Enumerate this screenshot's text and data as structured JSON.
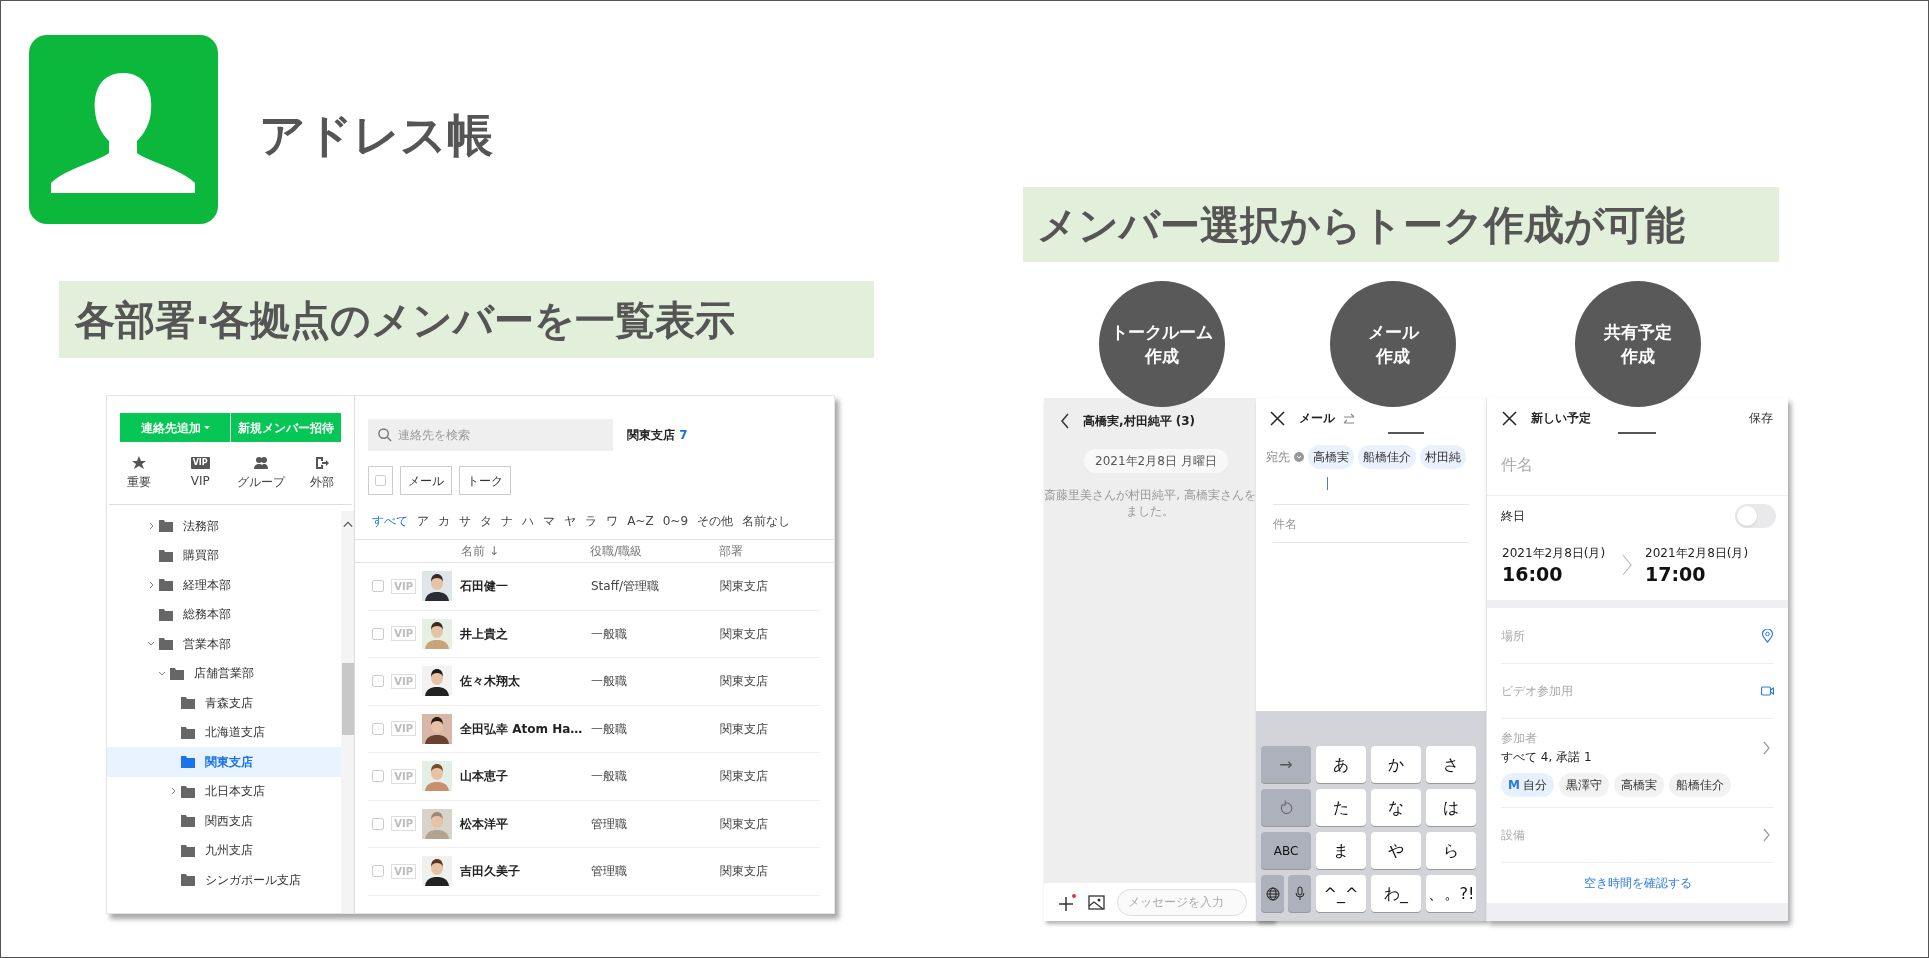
{
  "slide": {
    "title": "アドレス帳",
    "caption_left": "各部署·各拠点のメンバーを一覧表示",
    "caption_right": "メンバー選択からトーク作成が可能",
    "badges": [
      {
        "lines": [
          "トークルーム",
          "作成"
        ]
      },
      {
        "lines": [
          "メール",
          "作成"
        ]
      },
      {
        "lines": [
          "共有予定",
          "作成"
        ]
      }
    ]
  },
  "address_book": {
    "toolbar_buttons": [
      {
        "label": "連絡先追加",
        "dropdown": true
      },
      {
        "label": "新規メンバー招待",
        "dropdown": false
      }
    ],
    "quick_filters": [
      {
        "label": "重要",
        "kind": "star"
      },
      {
        "label": "VIP",
        "kind": "vip",
        "icon_text": "VIP"
      },
      {
        "label": "グループ",
        "kind": "group"
      },
      {
        "label": "外部",
        "kind": "external"
      }
    ],
    "tree": [
      {
        "label": "法務部",
        "has_children": true,
        "expanded": false,
        "selected": false
      },
      {
        "label": "購買部",
        "has_children": false,
        "selected": false
      },
      {
        "label": "経理本部",
        "has_children": true,
        "expanded": false,
        "selected": false
      },
      {
        "label": "総務本部",
        "has_children": false,
        "selected": false
      },
      {
        "label": "営業本部",
        "has_children": true,
        "expanded": true,
        "selected": false,
        "children": [
          {
            "label": "店舗営業部",
            "has_children": true,
            "expanded": true,
            "selected": false,
            "children": [
              {
                "label": "青森支店",
                "has_children": false,
                "selected": false
              },
              {
                "label": "北海道支店",
                "has_children": false,
                "selected": false
              },
              {
                "label": "関東支店",
                "has_children": false,
                "selected": true
              },
              {
                "label": "北日本支店",
                "has_children": true,
                "expanded": false,
                "selected": false
              },
              {
                "label": "関西支店",
                "has_children": false,
                "selected": false
              },
              {
                "label": "九州支店",
                "has_children": false,
                "selected": false
              },
              {
                "label": "シンガポール支店",
                "has_children": false,
                "selected": false
              }
            ]
          }
        ]
      }
    ],
    "search": {
      "placeholder": "連絡先を検索"
    },
    "heading": {
      "name": "関東支店",
      "count": "7"
    },
    "select_all": {
      "checked": false
    },
    "actions": [
      "メール",
      "トーク"
    ],
    "index_tabs": [
      {
        "label": "すべて",
        "selected": true
      },
      {
        "label": "ア",
        "selected": false
      },
      {
        "label": "カ",
        "selected": false
      },
      {
        "label": "サ",
        "selected": false
      },
      {
        "label": "タ",
        "selected": false
      },
      {
        "label": "ナ",
        "selected": false
      },
      {
        "label": "ハ",
        "selected": false
      },
      {
        "label": "マ",
        "selected": false
      },
      {
        "label": "ヤ",
        "selected": false
      },
      {
        "label": "ラ",
        "selected": false
      },
      {
        "label": "ワ",
        "selected": false
      },
      {
        "label": "A~Z",
        "selected": false
      },
      {
        "label": "0~9",
        "selected": false
      },
      {
        "label": "その他",
        "selected": false
      },
      {
        "label": "名前なし",
        "selected": false
      }
    ],
    "columns": [
      "名前 ↓",
      "役職/職級",
      "部署"
    ],
    "rows": [
      {
        "checked": false,
        "vip": "VIP",
        "name": "石田健一",
        "role": "Staff/管理職",
        "department": "関東支店"
      },
      {
        "checked": false,
        "vip": "VIP",
        "name": "井上貴之",
        "role": "一般職",
        "department": "関東支店"
      },
      {
        "checked": false,
        "vip": "VIP",
        "name": "佐々木翔太",
        "role": "一般職",
        "department": "関東支店"
      },
      {
        "checked": false,
        "vip": "VIP",
        "name": "全田弘幸 Atom Ha…",
        "role": "一般職",
        "department": "関東支店"
      },
      {
        "checked": false,
        "vip": "VIP",
        "name": "山本恵子",
        "role": "一般職",
        "department": "関東支店"
      },
      {
        "checked": false,
        "vip": "VIP",
        "name": "松本洋平",
        "role": "管理職",
        "department": "関東支店"
      },
      {
        "checked": false,
        "vip": "VIP",
        "name": "吉田久美子",
        "role": "管理職",
        "department": "関東支店"
      }
    ]
  },
  "talk_room": {
    "title": "高橋実,村田純平 (3)",
    "date": "2021年2月8日 月曜日",
    "system_message": [
      "斎藤里美さんが村田純平, 高橋実さんを",
      "ました。"
    ],
    "input_placeholder": "メッセージを入力"
  },
  "mail": {
    "title": "メール",
    "to_label": "宛先",
    "recipients": [
      "高橋実",
      "船橋佳介",
      "村田純"
    ],
    "subject_placeholder": "件名",
    "keyboard": [
      [
        {
          "kind": "function",
          "label": "→"
        },
        {
          "kind": "key",
          "label": "あ"
        },
        {
          "kind": "key",
          "label": "か"
        },
        {
          "kind": "key",
          "label": "さ"
        }
      ],
      [
        {
          "kind": "undo"
        },
        {
          "kind": "key",
          "label": "た"
        },
        {
          "kind": "key",
          "label": "な"
        },
        {
          "kind": "key",
          "label": "は"
        }
      ],
      [
        {
          "kind": "function",
          "label": "ABC"
        },
        {
          "kind": "key",
          "label": "ま"
        },
        {
          "kind": "key",
          "label": "や"
        },
        {
          "kind": "key",
          "label": "ら"
        }
      ],
      [
        {
          "kind": "globe"
        },
        {
          "kind": "key",
          "label": "^_^"
        },
        {
          "kind": "key",
          "label": "わ_"
        },
        {
          "kind": "key",
          "label": "、。?!"
        }
      ]
    ]
  },
  "schedule": {
    "title": "新しい予定",
    "save": "保存",
    "subject_placeholder": "件名",
    "all_day": {
      "label": "終日",
      "on": false
    },
    "start": {
      "date": "2021年2月8日(月)",
      "time": "16:00"
    },
    "end": {
      "date": "2021年2月8日(月)",
      "time": "17:00"
    },
    "location_placeholder": "場所",
    "video_placeholder": "ビデオ参加用",
    "participants": {
      "label": "参加者",
      "summary": "すべて 4, 承諾 1",
      "chips": [
        {
          "kind": "self",
          "initial": "M",
          "label": "自分"
        },
        {
          "kind": "member",
          "label": "黒澤守"
        },
        {
          "kind": "member",
          "label": "高橋実"
        },
        {
          "kind": "member",
          "label": "船橋佳介"
        }
      ]
    },
    "equipment": "設備",
    "check_availability": "空き時間を確認する"
  }
}
